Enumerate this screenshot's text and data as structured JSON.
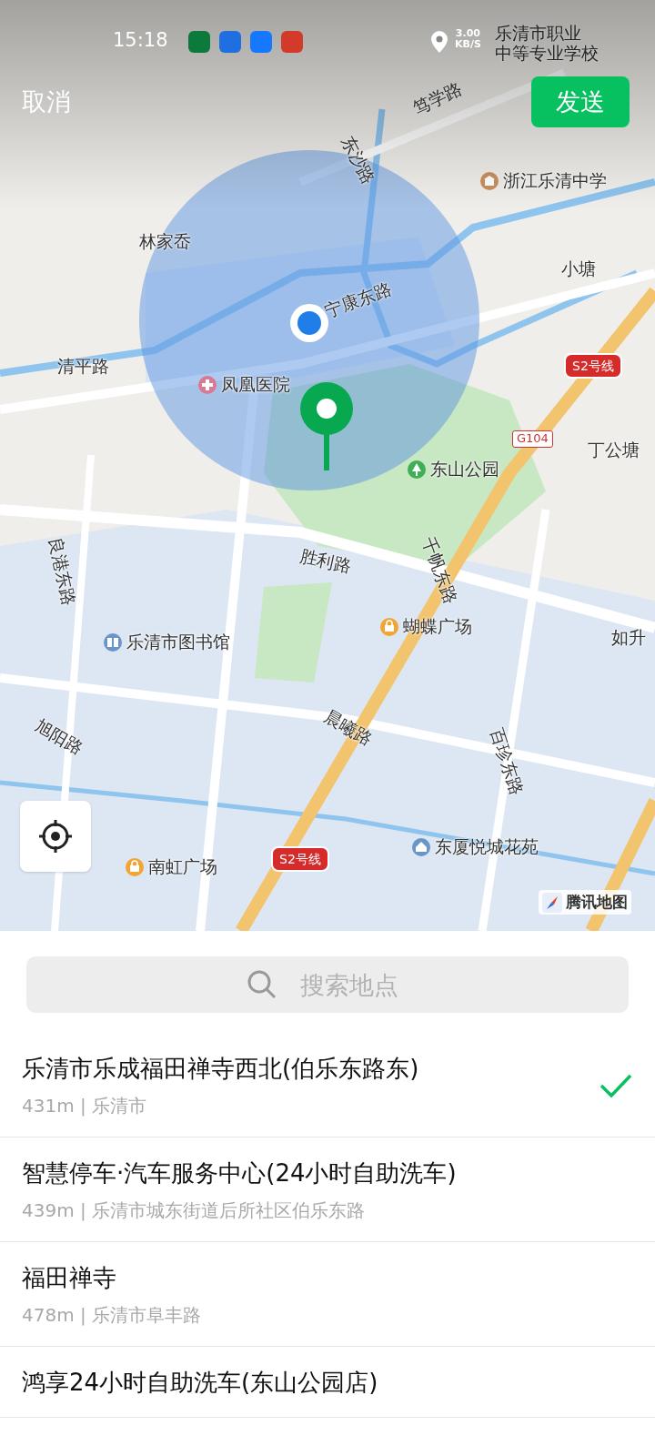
{
  "status_bar": {
    "time": "15:18",
    "net_speed": "3.00",
    "net_unit": "KB/S"
  },
  "header": {
    "cancel": "取消",
    "send": "发送"
  },
  "map": {
    "labels": [
      {
        "text": "乐清市职业",
        "kind": "place"
      },
      {
        "text": "中等专业学校",
        "kind": "place"
      },
      {
        "text": "笃学路",
        "kind": "road"
      },
      {
        "text": "东沙路",
        "kind": "road"
      },
      {
        "text": "浙江乐清中学",
        "kind": "school"
      },
      {
        "text": "林家岙",
        "kind": "place"
      },
      {
        "text": "小塘",
        "kind": "place"
      },
      {
        "text": "宁康东路",
        "kind": "road"
      },
      {
        "text": "清平路",
        "kind": "place"
      },
      {
        "text": "凤凰医院",
        "kind": "hospital"
      },
      {
        "text": "S2号线",
        "kind": "highway"
      },
      {
        "text": "G104",
        "kind": "route"
      },
      {
        "text": "丁公塘",
        "kind": "place"
      },
      {
        "text": "东山公园",
        "kind": "park"
      },
      {
        "text": "千帆东路",
        "kind": "road"
      },
      {
        "text": "良港东路",
        "kind": "road"
      },
      {
        "text": "胜利路",
        "kind": "road"
      },
      {
        "text": "蝴蝶广场",
        "kind": "mall"
      },
      {
        "text": "如升",
        "kind": "place"
      },
      {
        "text": "乐清市图书馆",
        "kind": "library"
      },
      {
        "text": "旭阳路",
        "kind": "road"
      },
      {
        "text": "晨曦路",
        "kind": "road"
      },
      {
        "text": "百珍东路",
        "kind": "road"
      },
      {
        "text": "东厦悦城花苑",
        "kind": "residence"
      },
      {
        "text": "S2号线",
        "kind": "highway"
      },
      {
        "text": "南虹广场",
        "kind": "mall"
      }
    ],
    "attribution": "腾讯地图"
  },
  "search": {
    "placeholder": "搜索地点"
  },
  "results": [
    {
      "name": "乐清市乐成福田禅寺西北(伯乐东路东)",
      "detail": "431m | 乐清市",
      "selected": true
    },
    {
      "name": "智慧停车·汽车服务中心(24小时自助洗车)",
      "detail": "439m | 乐清市城东街道后所社区伯乐东路",
      "selected": false
    },
    {
      "name": "福田禅寺",
      "detail": "478m | 乐清市阜丰路",
      "selected": false
    },
    {
      "name": "鸿享24小时自助洗车(东山公园店)",
      "selected": false
    }
  ]
}
